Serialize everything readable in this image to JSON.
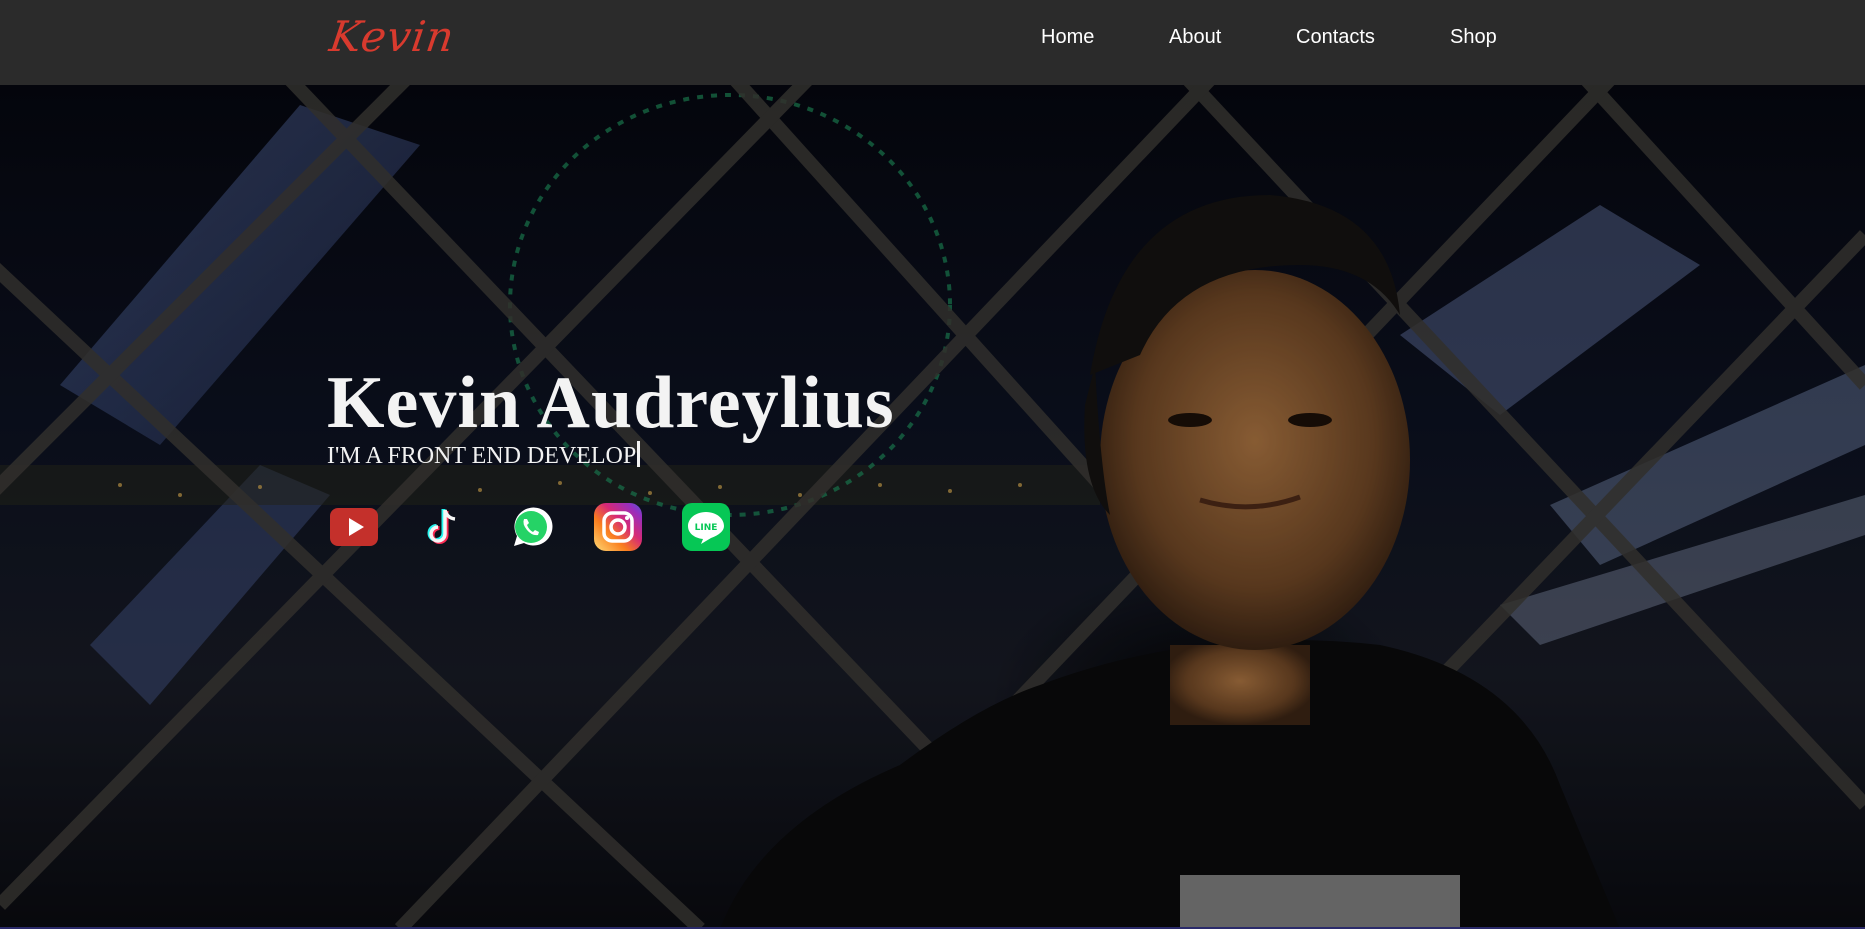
{
  "nav": {
    "logo": "Kevin",
    "links": [
      "Home",
      "About",
      "Contacts",
      "Shop"
    ]
  },
  "hero": {
    "name": "Kevin Audreylius",
    "tagline": "I'M A FRONT END DEVELOP"
  },
  "social_icons": [
    "youtube-icon",
    "tiktok-icon",
    "whatsapp-icon",
    "instagram-icon",
    "line-icon"
  ],
  "colors": {
    "navbar": "#2b2b2b",
    "logo": "#d83a2e",
    "youtube": "#c4302b",
    "whatsapp": "#25d366",
    "line": "#06c755"
  }
}
